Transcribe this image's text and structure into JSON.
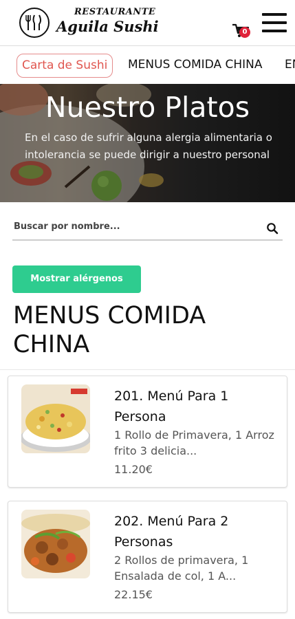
{
  "brand": {
    "top_line": "RESTAURANTE",
    "name": "Aguila Sushi",
    "logo_icon": "cutlery-logo-icon"
  },
  "cart": {
    "icon": "cart-icon",
    "count": "0",
    "badge_color": "#e0233a"
  },
  "menu_icon": "hamburger-icon",
  "tabs": [
    {
      "label": "Carta de Sushi",
      "active": true
    },
    {
      "label": "MENUS COMIDA CHINA",
      "active": false
    },
    {
      "label": "EN",
      "active": false
    }
  ],
  "hero": {
    "title": "Nuestro Platos",
    "subtitle": "En el caso de sufrir alguna alergia alimentaria o intolerancia se puede dirigir a nuestro personal"
  },
  "search": {
    "placeholder": "Buscar por nombre...",
    "icon": "search-icon"
  },
  "allergen_button": {
    "label": "Mostrar alérgenos",
    "color": "#2ecc8f"
  },
  "section": {
    "title": "MENUS COMIDA CHINA"
  },
  "items": [
    {
      "title": "201. Menú Para 1 Persona",
      "description": "1 Rollo de Primavera, 1 Arroz frito 3 delicia...",
      "price": "11.20€"
    },
    {
      "title": "202. Menú Para 2 Personas",
      "description": "2 Rollos de primavera, 1 Ensalada de col, 1 A...",
      "price": "22.15€"
    }
  ]
}
